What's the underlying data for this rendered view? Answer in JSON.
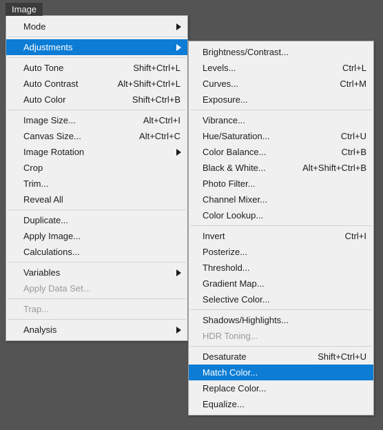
{
  "menubar": {
    "title": "Image",
    "accent_color": "#0c7cd5",
    "panel_bg": "#f0f0f0",
    "desktop_bg": "#545454"
  },
  "image_menu": {
    "name": "Image",
    "groups": [
      {
        "items": [
          {
            "label": "Mode",
            "accel": "",
            "submenu": true,
            "selected": false,
            "disabled": false
          }
        ]
      },
      {
        "items": [
          {
            "label": "Adjustments",
            "accel": "",
            "submenu": true,
            "selected": true,
            "disabled": false
          }
        ]
      },
      {
        "items": [
          {
            "label": "Auto Tone",
            "accel": "Shift+Ctrl+L",
            "submenu": false,
            "selected": false,
            "disabled": false
          },
          {
            "label": "Auto Contrast",
            "accel": "Alt+Shift+Ctrl+L",
            "submenu": false,
            "selected": false,
            "disabled": false
          },
          {
            "label": "Auto Color",
            "accel": "Shift+Ctrl+B",
            "submenu": false,
            "selected": false,
            "disabled": false
          }
        ]
      },
      {
        "items": [
          {
            "label": "Image Size...",
            "accel": "Alt+Ctrl+I",
            "submenu": false,
            "selected": false,
            "disabled": false
          },
          {
            "label": "Canvas Size...",
            "accel": "Alt+Ctrl+C",
            "submenu": false,
            "selected": false,
            "disabled": false
          },
          {
            "label": "Image Rotation",
            "accel": "",
            "submenu": true,
            "selected": false,
            "disabled": false
          },
          {
            "label": "Crop",
            "accel": "",
            "submenu": false,
            "selected": false,
            "disabled": false
          },
          {
            "label": "Trim...",
            "accel": "",
            "submenu": false,
            "selected": false,
            "disabled": false
          },
          {
            "label": "Reveal All",
            "accel": "",
            "submenu": false,
            "selected": false,
            "disabled": false
          }
        ]
      },
      {
        "items": [
          {
            "label": "Duplicate...",
            "accel": "",
            "submenu": false,
            "selected": false,
            "disabled": false
          },
          {
            "label": "Apply Image...",
            "accel": "",
            "submenu": false,
            "selected": false,
            "disabled": false
          },
          {
            "label": "Calculations...",
            "accel": "",
            "submenu": false,
            "selected": false,
            "disabled": false
          }
        ]
      },
      {
        "items": [
          {
            "label": "Variables",
            "accel": "",
            "submenu": true,
            "selected": false,
            "disabled": false
          },
          {
            "label": "Apply Data Set...",
            "accel": "",
            "submenu": false,
            "selected": false,
            "disabled": true
          }
        ]
      },
      {
        "items": [
          {
            "label": "Trap...",
            "accel": "",
            "submenu": false,
            "selected": false,
            "disabled": true
          }
        ]
      },
      {
        "items": [
          {
            "label": "Analysis",
            "accel": "",
            "submenu": true,
            "selected": false,
            "disabled": false
          }
        ]
      }
    ]
  },
  "adjustments_menu": {
    "name": "Adjustments",
    "groups": [
      {
        "items": [
          {
            "label": "Brightness/Contrast...",
            "accel": "",
            "submenu": false,
            "selected": false,
            "disabled": false
          },
          {
            "label": "Levels...",
            "accel": "Ctrl+L",
            "submenu": false,
            "selected": false,
            "disabled": false
          },
          {
            "label": "Curves...",
            "accel": "Ctrl+M",
            "submenu": false,
            "selected": false,
            "disabled": false
          },
          {
            "label": "Exposure...",
            "accel": "",
            "submenu": false,
            "selected": false,
            "disabled": false
          }
        ]
      },
      {
        "items": [
          {
            "label": "Vibrance...",
            "accel": "",
            "submenu": false,
            "selected": false,
            "disabled": false
          },
          {
            "label": "Hue/Saturation...",
            "accel": "Ctrl+U",
            "submenu": false,
            "selected": false,
            "disabled": false
          },
          {
            "label": "Color Balance...",
            "accel": "Ctrl+B",
            "submenu": false,
            "selected": false,
            "disabled": false
          },
          {
            "label": "Black & White...",
            "accel": "Alt+Shift+Ctrl+B",
            "submenu": false,
            "selected": false,
            "disabled": false
          },
          {
            "label": "Photo Filter...",
            "accel": "",
            "submenu": false,
            "selected": false,
            "disabled": false
          },
          {
            "label": "Channel Mixer...",
            "accel": "",
            "submenu": false,
            "selected": false,
            "disabled": false
          },
          {
            "label": "Color Lookup...",
            "accel": "",
            "submenu": false,
            "selected": false,
            "disabled": false
          }
        ]
      },
      {
        "items": [
          {
            "label": "Invert",
            "accel": "Ctrl+I",
            "submenu": false,
            "selected": false,
            "disabled": false
          },
          {
            "label": "Posterize...",
            "accel": "",
            "submenu": false,
            "selected": false,
            "disabled": false
          },
          {
            "label": "Threshold...",
            "accel": "",
            "submenu": false,
            "selected": false,
            "disabled": false
          },
          {
            "label": "Gradient Map...",
            "accel": "",
            "submenu": false,
            "selected": false,
            "disabled": false
          },
          {
            "label": "Selective Color...",
            "accel": "",
            "submenu": false,
            "selected": false,
            "disabled": false
          }
        ]
      },
      {
        "items": [
          {
            "label": "Shadows/Highlights...",
            "accel": "",
            "submenu": false,
            "selected": false,
            "disabled": false
          },
          {
            "label": "HDR Toning...",
            "accel": "",
            "submenu": false,
            "selected": false,
            "disabled": true
          }
        ]
      },
      {
        "items": [
          {
            "label": "Desaturate",
            "accel": "Shift+Ctrl+U",
            "submenu": false,
            "selected": false,
            "disabled": false
          },
          {
            "label": "Match Color...",
            "accel": "",
            "submenu": false,
            "selected": true,
            "disabled": false
          },
          {
            "label": "Replace Color...",
            "accel": "",
            "submenu": false,
            "selected": false,
            "disabled": false
          },
          {
            "label": "Equalize...",
            "accel": "",
            "submenu": false,
            "selected": false,
            "disabled": false
          }
        ]
      }
    ]
  }
}
